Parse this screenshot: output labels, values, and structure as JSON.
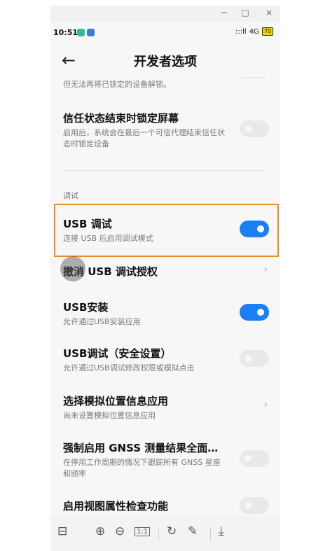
{
  "window": {
    "min_label": "−",
    "max_label": "□",
    "close_label": "×"
  },
  "status": {
    "time": "10:51",
    "signal": ":::ll",
    "network": "4G",
    "battery": "70"
  },
  "header": {
    "back_icon": "←",
    "title": "开发者选项"
  },
  "settings": {
    "top_partial_text": "但无法再将已锁定的设备解锁。",
    "trust_lock": {
      "title": "信任状态结束时锁定屏幕",
      "subtitle": "启用后，系统会在最后一个可信代理结束信任状态时锁定设备",
      "enabled": false
    },
    "debug_section_label": "调试",
    "usb_debugging": {
      "title": "USB 调试",
      "subtitle": "连接 USB 后启用调试模式",
      "enabled": true
    },
    "revoke_usb_auth": {
      "title": "撤消 USB 调试授权"
    },
    "usb_install": {
      "title": "USB安装",
      "subtitle": "允许通过USB安装应用",
      "enabled": true
    },
    "usb_debug_security": {
      "title": "USB调试（安全设置）",
      "subtitle": "允许通过USB调试修改权限或模拟点击",
      "enabled": false
    },
    "mock_location": {
      "title": "选择模拟位置信息应用",
      "subtitle": "尚未设置模拟位置信息应用"
    },
    "gnss": {
      "title": "强制启用 GNSS 测量结果全面…",
      "subtitle": "在停用工作周期的情况下跟踪所有 GNSS 星座和频率",
      "enabled": false
    },
    "view_attr": {
      "title": "启用视图属性检查功能",
      "enabled": false
    }
  },
  "toolbar": {
    "panel_icon": "⊟",
    "zoom_in_icon": "⊕",
    "zoom_out_icon": "⊖",
    "actual_size_label": "1:1",
    "rotate_icon": "↻",
    "edit_icon": "✎",
    "download_icon": "⤓"
  },
  "colors": {
    "accent": "#1a7ef6",
    "highlight": "#f08a24"
  }
}
